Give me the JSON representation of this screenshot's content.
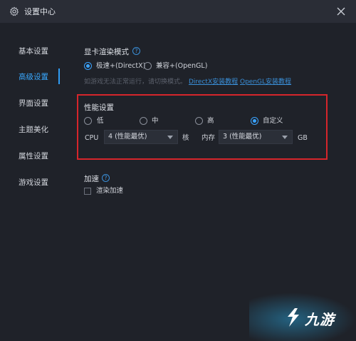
{
  "window": {
    "title": "设置中心"
  },
  "sidebar": {
    "items": [
      {
        "label": "基本设置"
      },
      {
        "label": "高级设置"
      },
      {
        "label": "界面设置"
      },
      {
        "label": "主题美化"
      },
      {
        "label": "属性设置"
      },
      {
        "label": "游戏设置"
      }
    ],
    "active_index": 1
  },
  "render_mode": {
    "title": "显卡渲染模式",
    "options": [
      {
        "label": "极速+(DirectX)",
        "checked": true
      },
      {
        "label": "兼容+(OpenGL)",
        "checked": false
      }
    ],
    "hint": "如游戏无法正常运行，请切换模式。",
    "links": [
      "DirectX安装教程",
      "OpenGL安装教程"
    ]
  },
  "performance": {
    "title": "性能设置",
    "options": [
      {
        "label": "低",
        "checked": false
      },
      {
        "label": "中",
        "checked": false
      },
      {
        "label": "高",
        "checked": false
      },
      {
        "label": "自定义",
        "checked": true
      }
    ],
    "cpu_label": "CPU",
    "cpu_value": "4 (性能最优)",
    "cpu_unit": "核",
    "memory_label": "内存",
    "memory_value": "3 (性能最优)",
    "memory_unit": "GB"
  },
  "acceleration": {
    "title": "加速",
    "checkbox_label": "渲染加速",
    "checked": false
  },
  "watermark": {
    "text": "九游"
  },
  "colors": {
    "accent": "#38a8ff",
    "highlight_border": "#d6252b",
    "background": "#1f2229"
  }
}
